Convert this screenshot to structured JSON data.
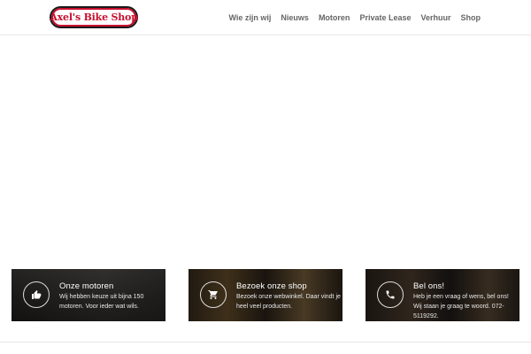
{
  "logo": {
    "text": "Axel's Bike Shop"
  },
  "nav": [
    {
      "label": "Wie zijn wij"
    },
    {
      "label": "Nieuws"
    },
    {
      "label": "Motoren"
    },
    {
      "label": "Private Lease"
    },
    {
      "label": "Verhuur"
    },
    {
      "label": "Shop"
    }
  ],
  "cards": [
    {
      "title": "Onze motoren",
      "text": "Wij hebben keuze uit bijna 150 motoren. Voor ieder wat wils.",
      "icon": "thumbs-up-icon"
    },
    {
      "title": "Bezoek onze shop",
      "text": "Bezoek onze webwinkel. Daar vindt je heel veel producten.",
      "icon": "shopping-cart-icon"
    },
    {
      "title": "Bel ons!",
      "text": "Heb je een vraag of wens, bel ons! Wij staan je graag te woord. 072-5119292.",
      "icon": "phone-icon"
    }
  ],
  "colors": {
    "brand_red": "#c8102e",
    "nav_text": "#666666",
    "card_title": "#ffffff"
  }
}
